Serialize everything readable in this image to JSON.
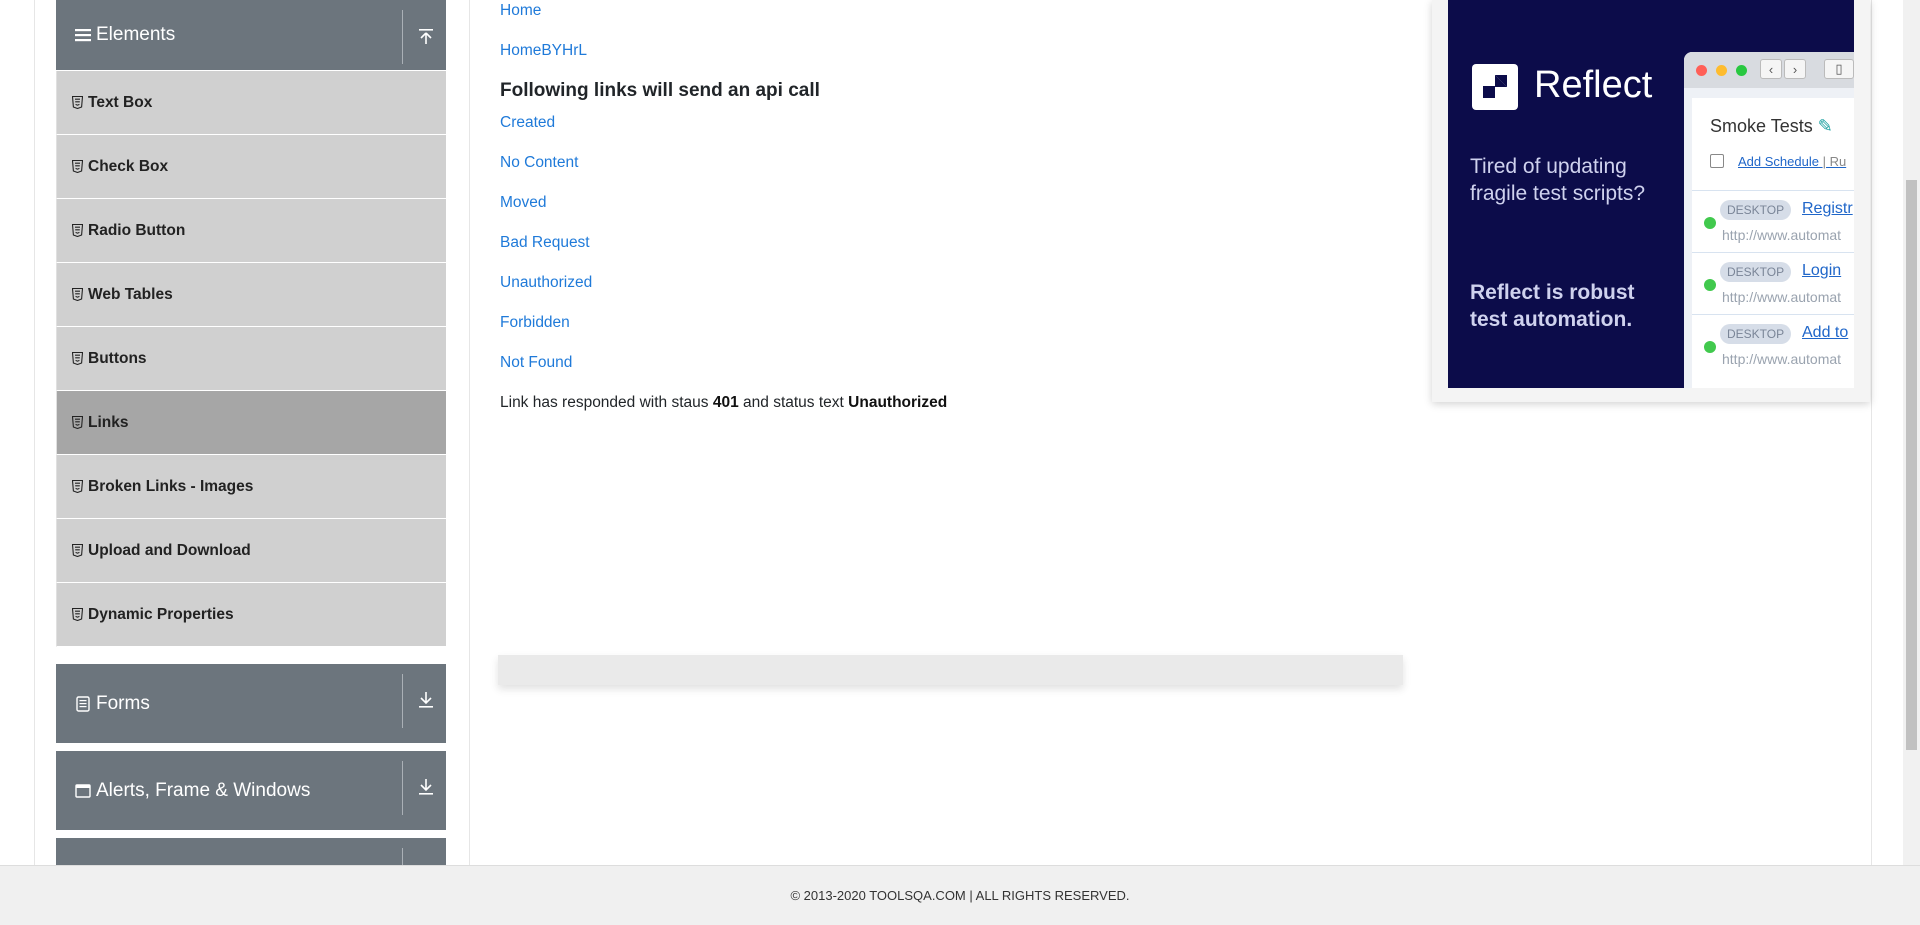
{
  "sidebar": {
    "elements_header": {
      "label": "Elements",
      "icon": "menu-icon",
      "toggle_icon": "collapse-up-icon"
    },
    "items": [
      {
        "label": "Text Box",
        "active": false
      },
      {
        "label": "Check Box",
        "active": false
      },
      {
        "label": "Radio Button",
        "active": false
      },
      {
        "label": "Web Tables",
        "active": false
      },
      {
        "label": "Buttons",
        "active": false
      },
      {
        "label": "Links",
        "active": true
      },
      {
        "label": "Broken Links - Images",
        "active": false
      },
      {
        "label": "Upload and Download",
        "active": false
      },
      {
        "label": "Dynamic Properties",
        "active": false
      }
    ],
    "forms_header": {
      "label": "Forms",
      "icon": "form-icon",
      "toggle_icon": "expand-down-icon"
    },
    "alerts_header": {
      "label": "Alerts, Frame & Windows",
      "icon": "window-icon",
      "toggle_icon": "expand-down-icon"
    }
  },
  "main": {
    "links_top": [
      {
        "label": "Home"
      },
      {
        "label": "HomeBYHrL"
      }
    ],
    "api_heading": "Following links will send an api call",
    "api_links": [
      {
        "label": "Created"
      },
      {
        "label": "No Content"
      },
      {
        "label": "Moved"
      },
      {
        "label": "Bad Request"
      },
      {
        "label": "Unauthorized"
      },
      {
        "label": "Forbidden"
      },
      {
        "label": "Not Found"
      }
    ],
    "response": {
      "prefix": "Link has responded with staus",
      "status_code": "401",
      "middle": "and status text",
      "status_text": "Unauthorized"
    }
  },
  "ad": {
    "brand": "Reflect",
    "tagline": "Tired of updating fragile test scripts?",
    "pitch": "Reflect is robust test automation.",
    "panel_title": "Smoke Tests",
    "schedule_link": "Add Schedule",
    "schedule_sep": "| Ru",
    "rows": [
      {
        "badge": "DESKTOP",
        "link": "Registr",
        "url": "http://www.automat"
      },
      {
        "badge": "DESKTOP",
        "link": "Login",
        "url": "http://www.automat"
      },
      {
        "badge": "DESKTOP",
        "link": "Add to",
        "url": "http://www.automat"
      }
    ],
    "colors": {
      "background": "#0c0c4a",
      "accent": "#41c94d"
    }
  },
  "footer": {
    "text": "© 2013-2020 TOOLSQA.COM | ALL RIGHTS RESERVED."
  },
  "colors": {
    "sidebar_header": "#6c757d",
    "menu_item": "#d0d0d0",
    "menu_item_active": "#a6a6a6",
    "link": "#1f7ad9"
  }
}
